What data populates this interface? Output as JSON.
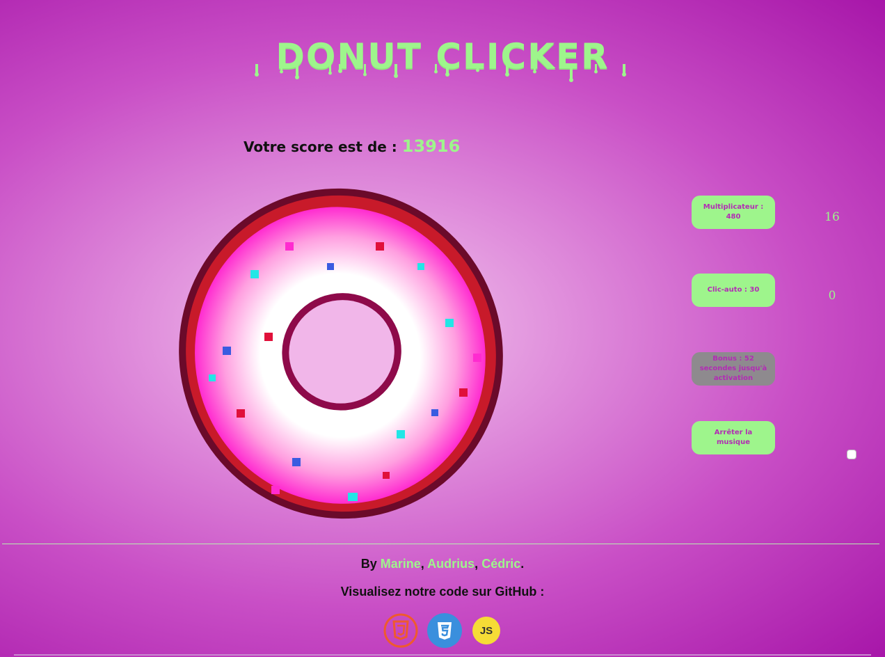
{
  "app": {
    "title": "DONUT CLICKER"
  },
  "score": {
    "label": "Votre score est de :",
    "value": "13916"
  },
  "buttons": {
    "multiplier": {
      "label": "Multiplicateur : 480",
      "count": "16"
    },
    "autoclick": {
      "label": "Clic-auto : 30",
      "count": "0"
    },
    "bonus": {
      "label": "Bonus : 52 secondes jusqu'à activation"
    },
    "music": {
      "label": "Arrêter la musique"
    }
  },
  "footer": {
    "by_prefix": "By",
    "authors": [
      "Marine",
      "Audrius",
      "Cédric"
    ],
    "sep": ",",
    "end": ".",
    "github_text": "Visualisez notre code sur GitHub :",
    "tech_icons": [
      "html5-icon",
      "css3-icon",
      "javascript-icon"
    ],
    "js_label": "JS"
  },
  "colors": {
    "accent_green": "#9ef58c",
    "button_text": "#b22cb4",
    "disabled_button": "#8e8a8e",
    "background": "#a716a9"
  }
}
